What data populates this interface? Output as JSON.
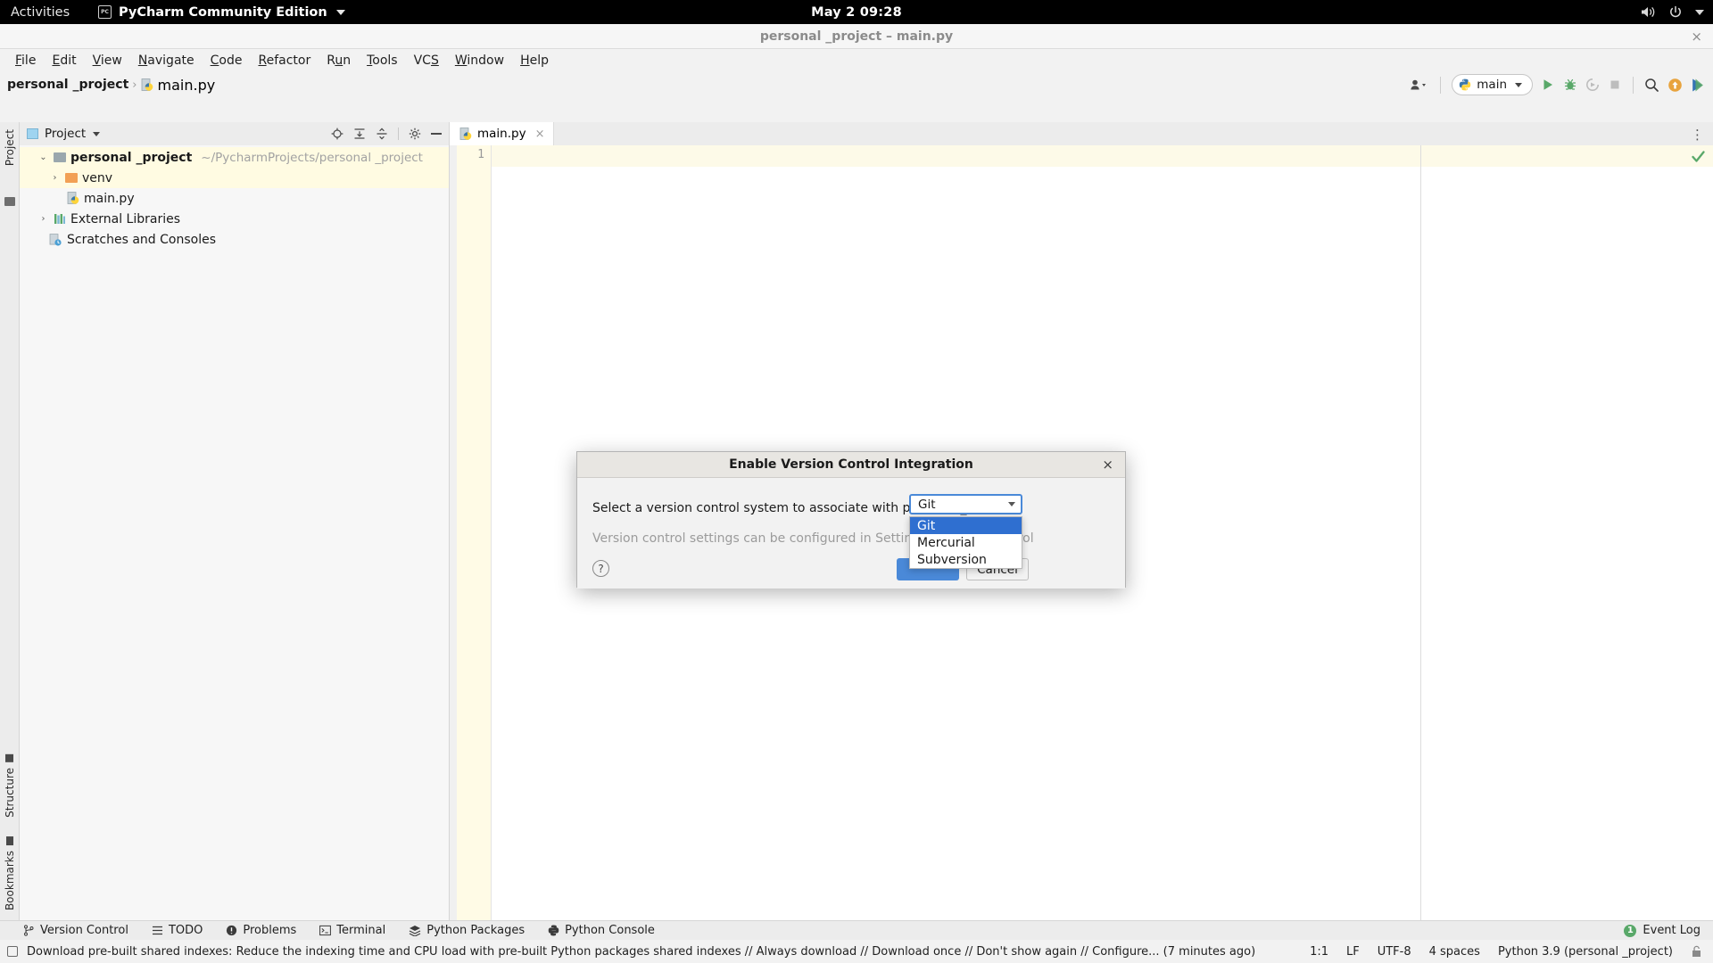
{
  "gnome": {
    "activities": "Activities",
    "app_name": "PyCharm Community Edition",
    "app_badge": "PC",
    "clock": "May 2  09:28",
    "icons": [
      "volume-icon",
      "power-icon",
      "chevron-down-icon"
    ]
  },
  "window": {
    "title": "personal _project – main.py",
    "close_label": "×"
  },
  "menubar": [
    {
      "label": "File",
      "mnemonic": "F"
    },
    {
      "label": "Edit",
      "mnemonic": "E"
    },
    {
      "label": "View",
      "mnemonic": "V"
    },
    {
      "label": "Navigate",
      "mnemonic": "N"
    },
    {
      "label": "Code",
      "mnemonic": "C"
    },
    {
      "label": "Refactor",
      "mnemonic": "R"
    },
    {
      "label": "Run",
      "mnemonic": "u"
    },
    {
      "label": "Tools",
      "mnemonic": "T"
    },
    {
      "label": "VCS",
      "mnemonic": "S"
    },
    {
      "label": "Window",
      "mnemonic": "W"
    },
    {
      "label": "Help",
      "mnemonic": "H"
    }
  ],
  "navbar": {
    "crumb_project": "personal _project",
    "separator": "›",
    "crumb_file": "main.py",
    "run_config": "main",
    "icons": [
      "user-dropdown-icon",
      "run-icon",
      "debug-icon",
      "coverage-icon",
      "stop-icon",
      "search-everywhere-icon",
      "update-icon",
      "run-anything-icon"
    ]
  },
  "project_panel": {
    "title": "Project",
    "header_icons": [
      "locate-icon",
      "expand-all-icon",
      "collapse-all-icon",
      "settings-gear-icon",
      "hide-icon"
    ],
    "tree": [
      {
        "name": "personal _project",
        "path": "~/PycharmProjects/personal _project",
        "arrow": "⌄",
        "icon": "folder-icon",
        "level": 0,
        "bold": true,
        "highlighted": true
      },
      {
        "name": "venv",
        "path": "",
        "arrow": "›",
        "icon": "folder-orange-icon",
        "level": 1,
        "bold": false,
        "highlighted": true
      },
      {
        "name": "main.py",
        "path": "",
        "arrow": "",
        "icon": "python-file-icon",
        "level": 2,
        "bold": false,
        "highlighted": false
      },
      {
        "name": "External Libraries",
        "path": "",
        "arrow": "›",
        "icon": "library-icon",
        "level": 0,
        "bold": false,
        "highlighted": false
      },
      {
        "name": "Scratches and Consoles",
        "path": "",
        "arrow": "",
        "icon": "scratches-icon",
        "level": 1,
        "bold": false,
        "highlighted": false
      }
    ]
  },
  "rails": {
    "project": "Project",
    "structure": "Structure",
    "bookmarks": "Bookmarks"
  },
  "editor": {
    "tab_label": "main.py",
    "tab_close": "×",
    "line_number": "1",
    "more_label": "⋮"
  },
  "dialog": {
    "title": "Enable Version Control Integration",
    "close": "×",
    "prompt": "Select a version control system to associate with personal _project:",
    "hint": "Version control settings can be configured in Settings | Version Control",
    "combo_value": "Git",
    "options": [
      {
        "label": "Git",
        "selected": true
      },
      {
        "label": "Mercurial",
        "selected": false
      },
      {
        "label": "Subversion",
        "selected": false
      }
    ],
    "help_label": "?",
    "ok_label": "OK",
    "cancel_label": "Cancel"
  },
  "tool_windows": [
    {
      "label": "Version Control",
      "icon": "branch-icon"
    },
    {
      "label": "TODO",
      "icon": "list-icon"
    },
    {
      "label": "Problems",
      "icon": "problems-icon"
    },
    {
      "label": "Terminal",
      "icon": "terminal-icon"
    },
    {
      "label": "Python Packages",
      "icon": "packages-icon"
    },
    {
      "label": "Python Console",
      "icon": "python-console-icon"
    }
  ],
  "event_log": {
    "label": "Event Log",
    "count": "1",
    "badge_color": "#59a869"
  },
  "statusbar": {
    "message": "Download pre-built shared indexes: Reduce the indexing time and CPU load with pre-built Python packages shared indexes // Always download // Download once // Don't show again // Configure... (7 minutes ago)",
    "caret": "1:1",
    "line_sep": "LF",
    "encoding": "UTF-8",
    "indent": "4 spaces",
    "interpreter": "Python 3.9 (personal _project)",
    "lock_icon": "lock-icon"
  },
  "colors": {
    "accent_blue": "#4a89d8",
    "select_blue": "#2f6fd0",
    "green": "#59a869",
    "orange": "#e8a33d",
    "highlight_row": "#fffbe2"
  }
}
